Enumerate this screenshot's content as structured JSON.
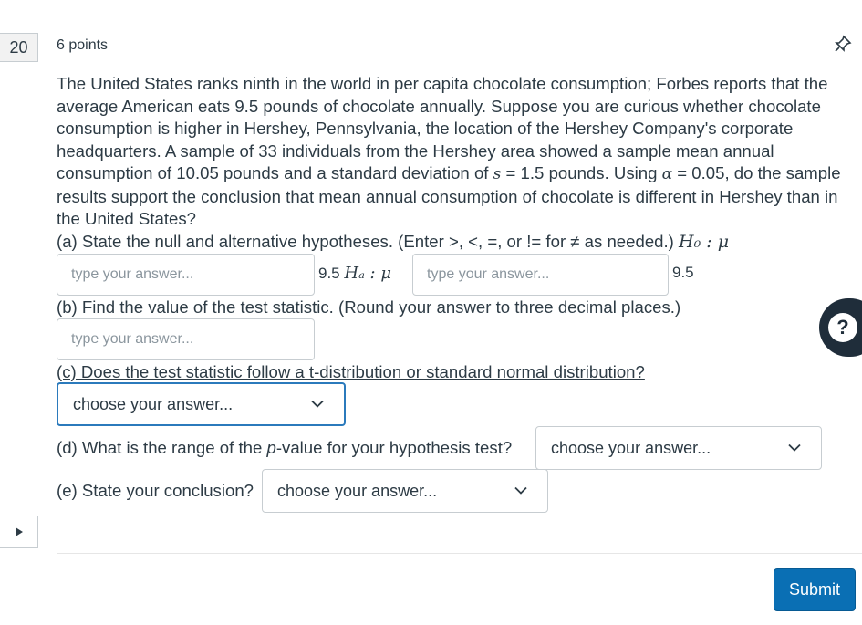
{
  "question": {
    "number": "20",
    "points": "6 points",
    "paragraph": "The United States ranks ninth in the world in per capita chocolate consumption; Forbes reports that the average American eats 9.5 pounds of chocolate annually. Suppose you are curious whether chocolate consumption is higher in Hershey, Pennsylvania, the location of the Hershey Company's corporate headquarters. A sample of 33 individuals from the Hershey area showed a sample mean annual consumption of 10.05 pounds and a standard deviation of ",
    "s_symbol": "s",
    "paragraph_mid": " = 1.5 pounds. Using ",
    "alpha_symbol": "α",
    "paragraph_end": " = 0.05, do the sample results support the conclusion that mean annual consumption of chocolate is different in Hershey than in the United States?",
    "part_a": "(a) State the null and alternative hypotheses. (Enter >, <, =, or != for ≠ as needed.) ",
    "h0": "H₀ : μ",
    "ha": "Hₐ : μ",
    "mu0_value_1": "9.5",
    "mu0_value_2": "9.5",
    "part_b": "(b) Find the value of the test statistic. (Round your answer to three decimal places.)",
    "part_c": "(c) Does the test statistic follow a t-distribution or standard normal distribution?",
    "part_d_prefix": "(d) What is the range of the ",
    "part_d_p": "p",
    "part_d_suffix": "-value for your hypothesis test?",
    "part_e": "(e) State your conclusion?"
  },
  "inputs": {
    "placeholder": "type your answer...",
    "select_placeholder": "choose your answer..."
  },
  "help_glyph": "?",
  "submit_label": "Submit",
  "icons": {
    "pin": "pin-icon",
    "chevron": "chevron-down-icon",
    "play": "play-icon"
  },
  "colors": {
    "accent": "#0a6fb4",
    "focus": "#2b7abc",
    "text": "#2d3b45",
    "help_bg": "#1f2d3a"
  }
}
